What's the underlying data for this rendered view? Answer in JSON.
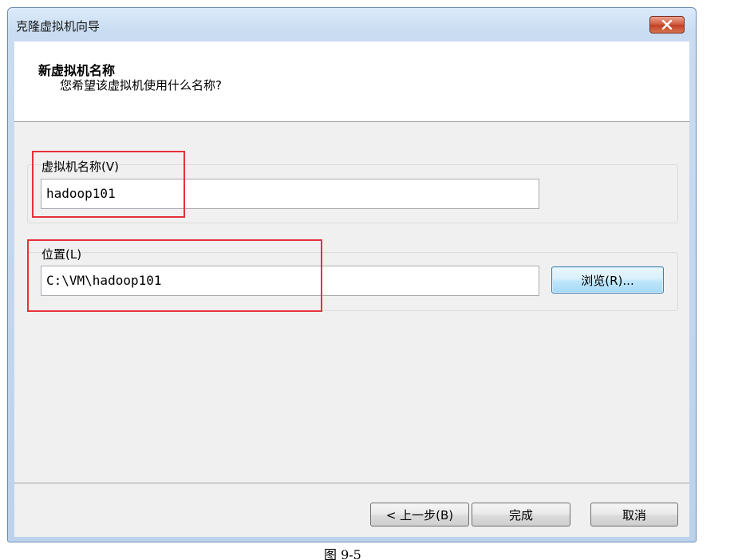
{
  "window": {
    "title": "克隆虚拟机向导",
    "close_icon": "close-icon"
  },
  "header": {
    "title": "新虚拟机名称",
    "subtitle": "您希望该虚拟机使用什么名称?"
  },
  "name_field": {
    "label": "虚拟机名称(V)",
    "value": "hadoop101"
  },
  "location_field": {
    "label": "位置(L)",
    "value": "C:\\VM\\hadoop101",
    "browse_label": "浏览(R)..."
  },
  "buttons": {
    "back": "< 上一步(B)",
    "finish": "完成",
    "cancel": "取消"
  },
  "highlight_color": "#e8303a",
  "caption": "图 9-5"
}
